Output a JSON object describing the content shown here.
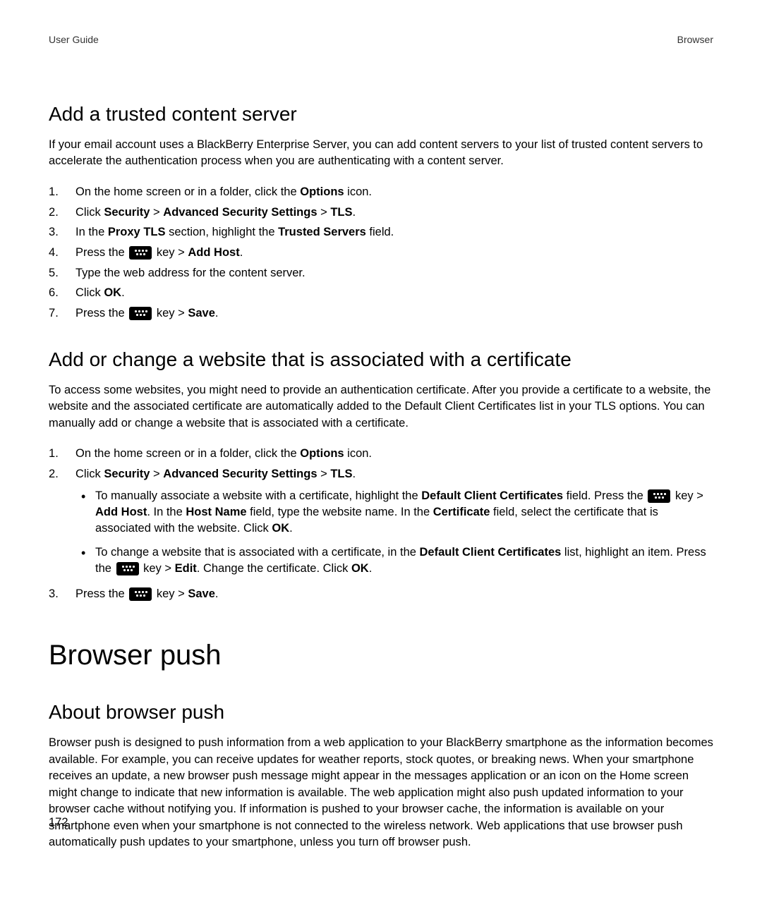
{
  "header": {
    "left": "User Guide",
    "right": "Browser"
  },
  "section1": {
    "title": "Add a trusted content server",
    "intro": "If your email account uses a BlackBerry Enterprise Server, you can add content servers to your list of trusted content servers to accelerate the authentication process when you are authenticating with a content server.",
    "steps": {
      "s1_pre": "On the home screen or in a folder, click the ",
      "s1_b1": "Options",
      "s1_post": " icon.",
      "s2_pre": "Click ",
      "s2_b1": "Security",
      "s2_sep1": " > ",
      "s2_b2": "Advanced Security Settings",
      "s2_sep2": " > ",
      "s2_b3": "TLS",
      "s2_post": ".",
      "s3_pre": "In the ",
      "s3_b1": "Proxy TLS",
      "s3_mid": " section, highlight the ",
      "s3_b2": "Trusted Servers",
      "s3_post": " field.",
      "s4_pre": "Press the ",
      "s4_mid": " key > ",
      "s4_b1": "Add Host",
      "s4_post": ".",
      "s5": "Type the web address for the content server.",
      "s6_pre": "Click ",
      "s6_b1": "OK",
      "s6_post": ".",
      "s7_pre": "Press the ",
      "s7_mid": " key > ",
      "s7_b1": "Save",
      "s7_post": "."
    }
  },
  "section2": {
    "title": "Add or change a website that is associated with a certificate",
    "intro": "To access some websites, you might need to provide an authentication certificate. After you provide a certificate to a website, the website and the associated certificate are automatically added to the Default Client Certificates list in your TLS options. You can manually add or change a website that is associated with a certificate.",
    "steps": {
      "s1_pre": "On the home screen or in a folder, click the ",
      "s1_b1": "Options",
      "s1_post": " icon.",
      "s2_pre": "Click ",
      "s2_b1": "Security",
      "s2_sep1": " > ",
      "s2_b2": "Advanced Security Settings",
      "s2_sep2": " > ",
      "s2_b3": "TLS",
      "s2_post": ".",
      "b1_pre": "To manually associate a website with a certificate, highlight the ",
      "b1_b1": "Default Client Certificates",
      "b1_mid1": " field. Press the ",
      "b1_mid2": " key > ",
      "b1_b2": "Add Host",
      "b1_mid3": ". In the ",
      "b1_b3": "Host Name",
      "b1_mid4": " field, type the website name. In the ",
      "b1_b4": "Certificate",
      "b1_mid5": " field, select the certificate that is associated with the website. Click ",
      "b1_b5": "OK",
      "b1_post": ".",
      "b2_pre": "To change a website that is associated with a certificate, in the ",
      "b2_b1": "Default Client Certificates",
      "b2_mid1": " list, highlight an item. Press the ",
      "b2_mid2": " key > ",
      "b2_b2": "Edit",
      "b2_mid3": ". Change the certificate. Click ",
      "b2_b3": "OK",
      "b2_post": ".",
      "s3_pre": "Press the ",
      "s3_mid": " key > ",
      "s3_b1": "Save",
      "s3_post": "."
    }
  },
  "section3": {
    "major_title": "Browser push",
    "title": "About browser push",
    "paragraph": "Browser push is designed to push information from a web application to your BlackBerry smartphone as the information becomes available. For example, you can receive updates for weather reports, stock quotes, or breaking news. When your smartphone receives an update, a new browser push message might appear in the messages application or an icon on the Home screen might change to indicate that new information is available. The web application might also push updated information to your browser cache without notifying you. If information is pushed to your browser cache, the information is available on your smartphone even when your smartphone is not connected to the wireless network. Web applications that use browser push automatically push updates to your smartphone, unless you turn off browser push."
  },
  "page_number": "172"
}
